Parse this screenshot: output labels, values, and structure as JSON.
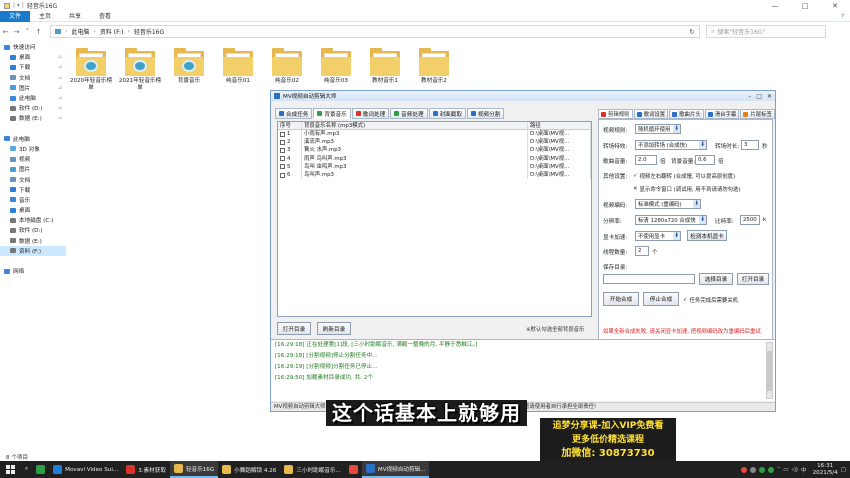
{
  "explorer": {
    "title": "轻音乐16G",
    "ribbon_tabs": [
      "文件",
      "主页",
      "共享",
      "查看"
    ],
    "breadcrumb": [
      "此电脑",
      "资料 (F:)",
      "轻音乐16G"
    ],
    "search_placeholder": "搜索\"轻音乐16G\"",
    "nav_items": [
      {
        "label": "快速访问",
        "pinned": false,
        "color": "#3a86d8"
      },
      {
        "label": "桌面",
        "pinned": true,
        "color": "#2b7fd4"
      },
      {
        "label": "下载",
        "pinned": true,
        "color": "#2b7fd4"
      },
      {
        "label": "文档",
        "pinned": true,
        "color": "#6b8fb8"
      },
      {
        "label": "图片",
        "pinned": true,
        "color": "#4a9bd8"
      },
      {
        "label": "此电脑",
        "pinned": true,
        "color": "#3a86d8"
      },
      {
        "label": "软件 (D:)",
        "pinned": true,
        "color": "#777777"
      },
      {
        "label": "数据 (E:)",
        "pinned": true,
        "color": "#777777"
      },
      {
        "label": "",
        "pinned": false,
        "color": "#ffffff"
      },
      {
        "label": "此电脑",
        "pinned": false,
        "color": "#3a86d8"
      },
      {
        "label": "3D 对象",
        "pinned": false,
        "color": "#5aa9e6"
      },
      {
        "label": "视频",
        "pinned": false,
        "color": "#6b8fb8"
      },
      {
        "label": "图片",
        "pinned": false,
        "color": "#4a9bd8"
      },
      {
        "label": "文档",
        "pinned": false,
        "color": "#6b8fb8"
      },
      {
        "label": "下载",
        "pinned": false,
        "color": "#2b7fd4"
      },
      {
        "label": "音乐",
        "pinned": false,
        "color": "#3a86d8"
      },
      {
        "label": "桌面",
        "pinned": false,
        "color": "#2b7fd4"
      },
      {
        "label": "本地磁盘 (C:)",
        "pinned": false,
        "color": "#777777"
      },
      {
        "label": "软件 (D:)",
        "pinned": false,
        "color": "#777777"
      },
      {
        "label": "数据 (E:)",
        "pinned": false,
        "color": "#777777"
      },
      {
        "label": "资料 (F:)",
        "pinned": false,
        "color": "#777777"
      },
      {
        "label": "",
        "pinned": false,
        "color": "#ffffff"
      },
      {
        "label": "网络",
        "pinned": false,
        "color": "#3a86d8"
      }
    ],
    "selected_nav": 20,
    "folders": [
      {
        "name": "2020年轻音乐榜单",
        "badge": true
      },
      {
        "name": "2021年轻音乐榜单",
        "badge": true
      },
      {
        "name": "背景音乐",
        "badge": true
      },
      {
        "name": "纯音乐01",
        "badge": false
      },
      {
        "name": "纯音乐02",
        "badge": false
      },
      {
        "name": "纯音乐03",
        "badge": false
      },
      {
        "name": "教材音乐1",
        "badge": false
      },
      {
        "name": "教材音乐2",
        "badge": false
      }
    ],
    "status": "8 个项目"
  },
  "app": {
    "title": "MV视频自动剪辑大师",
    "toolbar": [
      "合成任务",
      "背景音乐",
      "歌词处理",
      "音频处理",
      "封面截取",
      "视频分割"
    ],
    "active_toolbar": 1,
    "table": {
      "headers": [
        "序号",
        "背景音乐名称 (mp3模式)",
        "路径"
      ],
      "rows": [
        {
          "no": "1",
          "name": "小雨有声.mp3",
          "path": "D:\\桌面\\MV视..."
        },
        {
          "no": "2",
          "name": "溪流声.mp3",
          "path": "D:\\桌面\\MV视..."
        },
        {
          "no": "3",
          "name": "篝火 水声.mp3",
          "path": "D:\\桌面\\MV视..."
        },
        {
          "no": "4",
          "name": "雨声 鸟叫声.mp3",
          "path": "D:\\桌面\\MV视..."
        },
        {
          "no": "5",
          "name": "鸟叫 虫鸣声.mp3",
          "path": "D:\\桌面\\MV视..."
        },
        {
          "no": "6",
          "name": "鸟叫声.mp3",
          "path": "D:\\桌面\\MV视..."
        }
      ]
    },
    "open_dir": "打开目录",
    "refresh_dir": "刷新目录",
    "default_note": "※默认勾选全部背景音乐",
    "right_tabs": [
      "剪辑规则",
      "歌词设置",
      "歌曲片头",
      "滑台字幕",
      "片尾标签"
    ],
    "settings": {
      "video_rule_label": "视频规则:",
      "video_rule_value": "随机循环使用",
      "transition_label": "转场特效:",
      "transition_value": "不添加转场 (合成快)",
      "transition_time_label": "转场时长:",
      "transition_time_value": "3",
      "seconds": "秒",
      "song_vol_label": "歌曲音量:",
      "song_vol_value": "2.0",
      "times1": "倍",
      "bg_vol_label": "背景音量:",
      "bg_vol_value": "0.6",
      "times2": "倍",
      "other_label": "其他设置:",
      "opt1": "视频左右翻转 (合成慢, 可以提高原创度)",
      "opt2": "显示命令窗口 (调试用, 用不到请请勿勾选)",
      "encode_label": "视频编码:",
      "encode_value": "标准模式 (重编码)",
      "resolution_label": "分辨率:",
      "resolution_value": "标清 1280x720 合成快",
      "bitrate_label": "比特率:",
      "bitrate_value": "2500",
      "bitrate_unit": "k",
      "gpu_label": "显卡加速:",
      "gpu_value": "不使用显卡",
      "gpu_detect": "检测本机显卡",
      "threads_label": "线程数量:",
      "threads_value": "2",
      "threads_unit": "个",
      "save_label": "保存目录:",
      "save_value": "",
      "choose_dir": "选择目录",
      "open_dir": "打开目录",
      "start": "开始合成",
      "stop": "停止合成",
      "shutdown": "任务完成后需要关机",
      "warning": "如果全新合成失败, 请关闭显卡加速, 把视频编码改为重编码后重试"
    },
    "log": [
      "[16:29:18] 正在处理第[1]段, [三小时助眠音乐, 满载一整晚的月, 平静于悉触江。]",
      "[16:29:18] [分割视频]停止分割任务中...",
      "[16:29:19] [分割视频]分割任务已停止...",
      "[16:29:50] 加载素材目录成功, 共: 2个"
    ],
    "status": "MV视频自动剪辑大师 · 批量合成背景音乐视频 · 请遵守相关法律法规 · 如有侵权请联系作者修改 · 如有问题请使用者自行承担全部责任!"
  },
  "overlay": {
    "subtitle": "这个话基本上就够用",
    "promo": [
      "追梦分享课-加入VIP免费看",
      "更多低价精选课程",
      "加微信: 30873730"
    ]
  },
  "taskbar": {
    "items": [
      {
        "label": "",
        "color": "#2ea043",
        "active": false
      },
      {
        "label": "Movavi Video Sui...",
        "color": "#1f7fd6",
        "active": false
      },
      {
        "label": "3.素材获取",
        "color": "#d9332c",
        "active": false
      },
      {
        "label": "轻音乐16G",
        "color": "#e6b84e",
        "active": true
      },
      {
        "label": "小舞蹈解锁 4.26",
        "color": "#e6b84e",
        "active": false
      },
      {
        "label": "三小时助眠音乐...",
        "color": "#e6b84e",
        "active": false
      },
      {
        "label": "",
        "color": "#e64a3b",
        "active": false
      },
      {
        "label": "MV视频自动剪辑...",
        "color": "#2a70c8",
        "active": true
      }
    ],
    "time": "16:31",
    "date": "2021/5/4",
    "ime": "中"
  }
}
